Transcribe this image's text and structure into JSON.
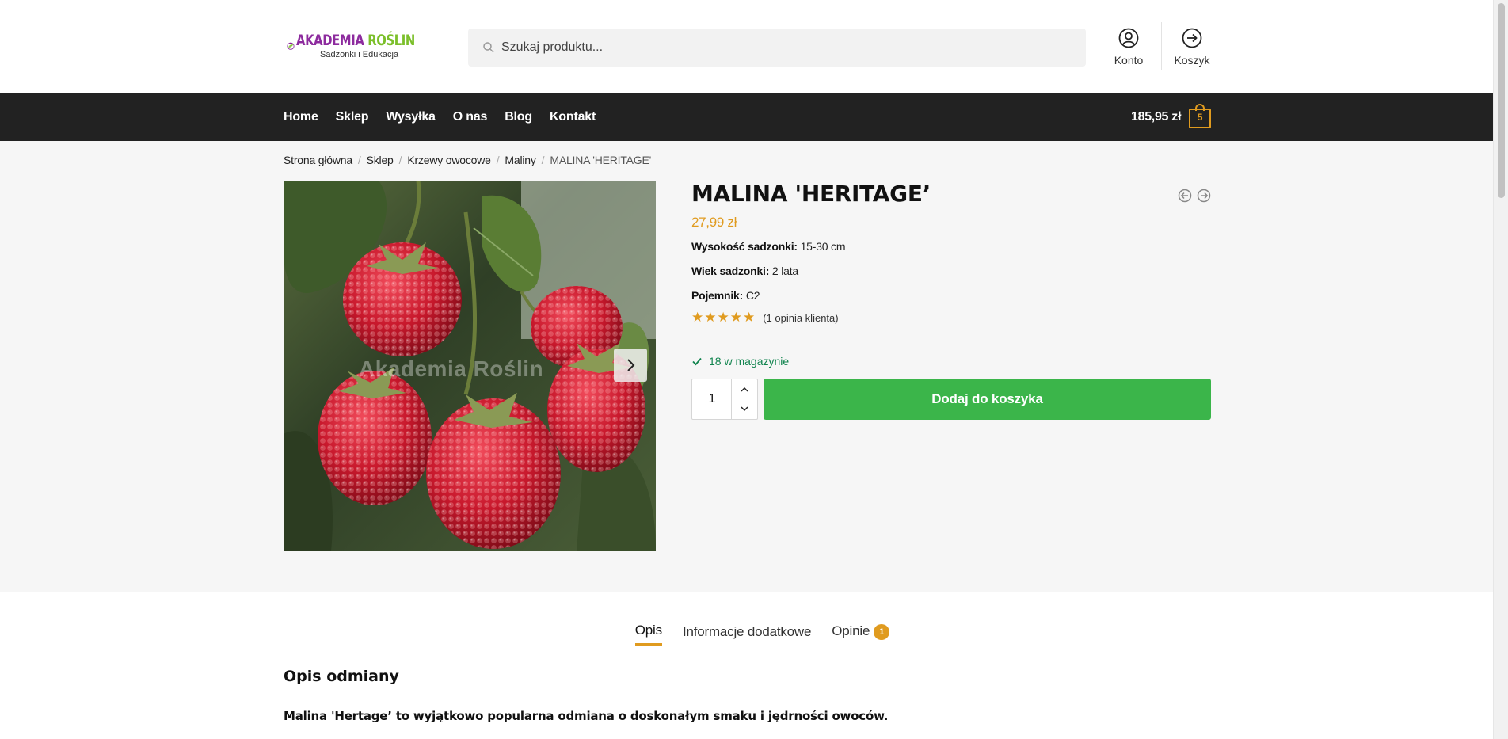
{
  "brand": {
    "name_part1": "AKADEMIA ",
    "name_part2": "ROŚLIN",
    "tagline": "Sadzonki i Edukacja"
  },
  "search": {
    "placeholder": "Szukaj produktu..."
  },
  "header": {
    "account_label": "Konto",
    "cart_label": "Koszyk"
  },
  "nav": {
    "items": [
      {
        "label": "Home"
      },
      {
        "label": "Sklep"
      },
      {
        "label": "Wysyłka"
      },
      {
        "label": "O nas"
      },
      {
        "label": "Blog"
      },
      {
        "label": "Kontakt"
      }
    ],
    "cart_total": "185,95 zł",
    "cart_count": "5"
  },
  "breadcrumb": {
    "items": [
      "Strona główna",
      "Sklep",
      "Krzewy owocowe",
      "Maliny"
    ],
    "current": "MALINA 'HERITAGE'"
  },
  "gallery": {
    "watermark": "Akademia Roślin"
  },
  "product": {
    "title": "MALINA 'HERITAGE’",
    "price": "27,99 zł",
    "attributes": [
      {
        "label": "Wysokość sadzonki:",
        "value": "15-30 cm"
      },
      {
        "label": "Wiek sadzonki:",
        "value": "2 lata"
      },
      {
        "label": "Pojemnik:",
        "value": "C2"
      }
    ],
    "rating_stars": "★★★★★",
    "rating_value": 5,
    "review_text": "(1 opinia klienta)",
    "stock": "18 w magazynie",
    "quantity": "1",
    "add_to_cart": "Dodaj do koszyka"
  },
  "tabs": {
    "items": [
      {
        "label": "Opis",
        "active": true
      },
      {
        "label": "Informacje dodatkowe",
        "active": false
      },
      {
        "label": "Opinie",
        "active": false,
        "badge": "1"
      }
    ]
  },
  "description": {
    "heading": "Opis odmiany",
    "lead": "Malina 'Hertage’ to wyjątkowo popularna odmiana o doskonałym smaku i jędrności owoców."
  },
  "colors": {
    "accent": "#e09b1f",
    "button": "#3bb54a",
    "navbar": "#222222",
    "stock": "#0f834d",
    "brand_purple": "#8d2b9e",
    "brand_green": "#7bbf2a"
  }
}
